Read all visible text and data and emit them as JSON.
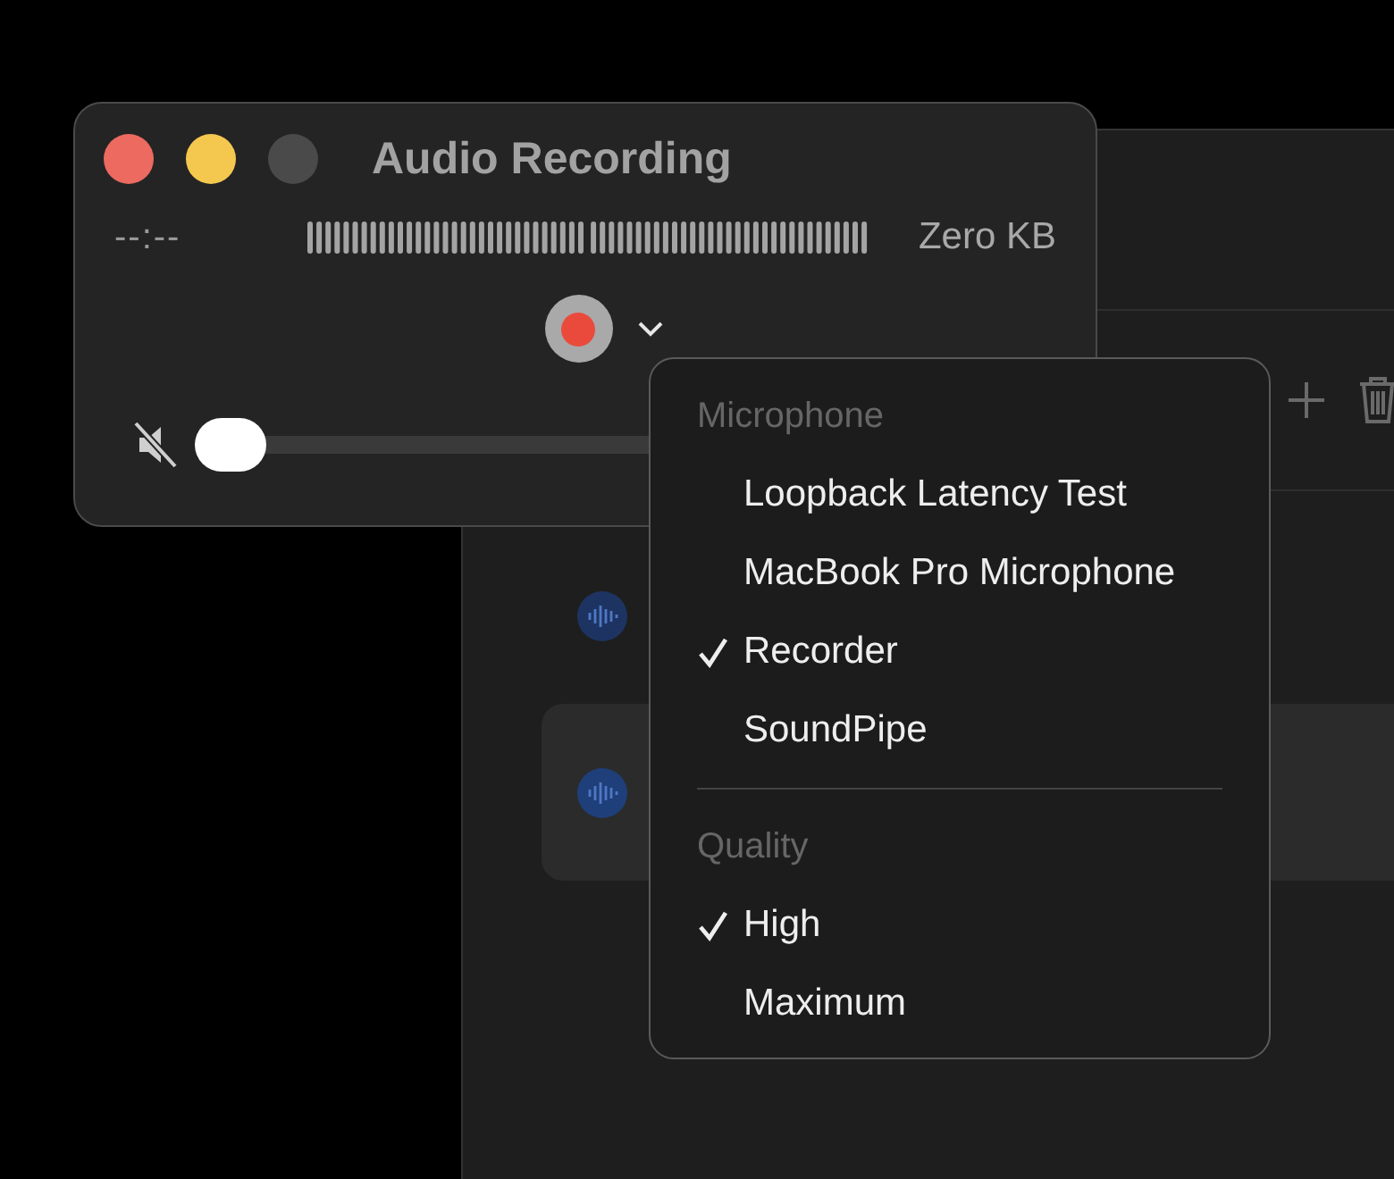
{
  "recordings_window": {
    "rows": [
      {
        "selected": false
      },
      {
        "selected": true
      }
    ]
  },
  "recorder": {
    "title": "Audio Recording",
    "elapsed": "--:--",
    "file_size": "Zero KB",
    "volume": {
      "muted": true,
      "level": 0
    }
  },
  "menu": {
    "sections": [
      {
        "heading": "Microphone",
        "items": [
          {
            "label": "Loopback Latency Test",
            "checked": false
          },
          {
            "label": "MacBook Pro Microphone",
            "checked": false
          },
          {
            "label": "Recorder",
            "checked": true
          },
          {
            "label": "SoundPipe",
            "checked": false
          }
        ]
      },
      {
        "heading": "Quality",
        "items": [
          {
            "label": "High",
            "checked": true
          },
          {
            "label": "Maximum",
            "checked": false
          }
        ]
      }
    ]
  }
}
